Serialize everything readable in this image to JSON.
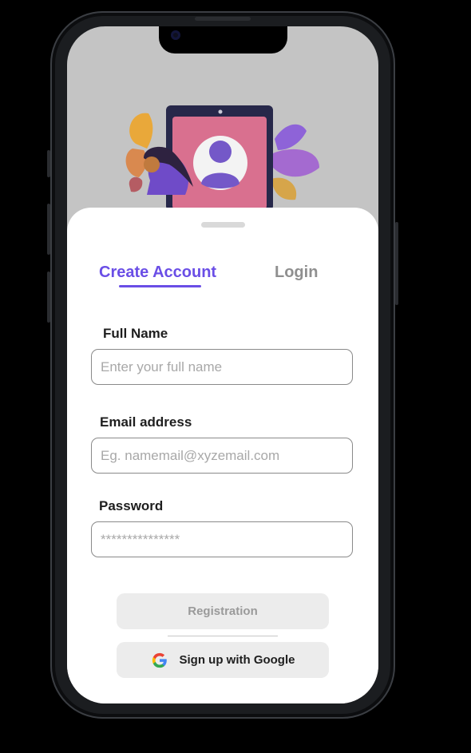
{
  "tabs": {
    "create_account": "Create Account",
    "login": "Login"
  },
  "form": {
    "full_name": {
      "label": "Full Name",
      "placeholder": "Enter your full name",
      "value": ""
    },
    "email": {
      "label": "Email address",
      "placeholder": "Eg. namemail@xyzemail.com",
      "value": ""
    },
    "password": {
      "label": "Password",
      "placeholder": "***************",
      "value": ""
    }
  },
  "actions": {
    "registration": "Registration",
    "google": "Sign up with Google"
  },
  "colors": {
    "accent": "#6a4ee6",
    "button_bg": "#ececec",
    "screen_top": "#c4c4c4",
    "sheet": "#ffffff"
  },
  "icons": {
    "google": "google-g-icon",
    "illustration": "profile-card-illustration"
  }
}
